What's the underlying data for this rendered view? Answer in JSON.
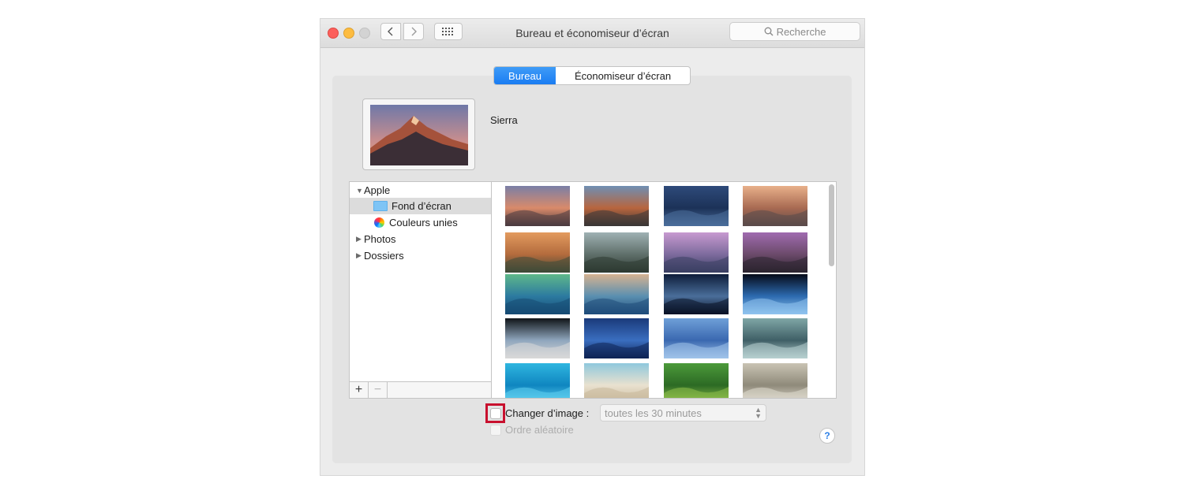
{
  "window": {
    "title": "Bureau et économiseur d’écran",
    "search_placeholder": "Recherche",
    "traffic_lights": {
      "close": "#fc605c",
      "minimize": "#fdbc40",
      "maximize": "#d3d3d3"
    },
    "nav_icons": [
      "chevron-left-icon",
      "chevron-right-icon",
      "grid-icon"
    ]
  },
  "tabs": [
    {
      "label": "Bureau",
      "selected": true
    },
    {
      "label": "Économiseur d’écran",
      "selected": false
    }
  ],
  "current_wallpaper": {
    "name": "Sierra"
  },
  "source_list": {
    "items": [
      {
        "label": "Apple",
        "type": "group",
        "expanded": true
      },
      {
        "label": "Fond d’écran",
        "type": "folder",
        "selected": true
      },
      {
        "label": "Couleurs unies",
        "type": "colors",
        "selected": false
      },
      {
        "label": "Photos",
        "type": "group",
        "expanded": false
      },
      {
        "label": "Dossiers",
        "type": "group",
        "expanded": false
      }
    ],
    "add_label": "+",
    "remove_label": "−"
  },
  "wallpaper_grid": [
    {
      "name": "sierra",
      "colors": [
        "#7a7fa6",
        "#d98a6a",
        "#4a3b3f"
      ]
    },
    {
      "name": "el-capitan",
      "colors": [
        "#6f8fb3",
        "#b8653e",
        "#3a3636"
      ]
    },
    {
      "name": "mountain-night",
      "colors": [
        "#2e4a7a",
        "#1c3258",
        "#4b6d9a"
      ]
    },
    {
      "name": "yosemite-dusk",
      "colors": [
        "#e8b08a",
        "#a86a52",
        "#5a4a4a"
      ]
    },
    {
      "name": "yosemite-sunset",
      "colors": [
        "#e39b5f",
        "#b36b3d",
        "#3e4a38"
      ]
    },
    {
      "name": "yosemite-forest",
      "colors": [
        "#9fb1b3",
        "#5f6f6a",
        "#2d3a32"
      ]
    },
    {
      "name": "half-dome-pink",
      "colors": [
        "#c79ad0",
        "#7d6b9d",
        "#3a3f63"
      ]
    },
    {
      "name": "lake-rocks",
      "colors": [
        "#a06bb0",
        "#6b4a6a",
        "#2c2430"
      ]
    },
    {
      "name": "green-wave",
      "colors": [
        "#5fb88a",
        "#2c7aa0",
        "#164a73"
      ]
    },
    {
      "name": "ocean-wave",
      "colors": [
        "#d6b391",
        "#5a8fb0",
        "#1f4c7a"
      ]
    },
    {
      "name": "galaxy",
      "colors": [
        "#0e1d3a",
        "#4a6e9a",
        "#0a1226"
      ]
    },
    {
      "name": "earth-horizon",
      "colors": [
        "#050a18",
        "#2d6bb0",
        "#8fc3ee"
      ]
    },
    {
      "name": "earth-from-space",
      "colors": [
        "#101418",
        "#8fa6bd",
        "#d8d8d8"
      ]
    },
    {
      "name": "blue-nebula",
      "colors": [
        "#1a3a7a",
        "#3a6ec0",
        "#0e2456"
      ]
    },
    {
      "name": "blue-sky",
      "colors": [
        "#6fa0d8",
        "#3a68b0",
        "#9fc2ea"
      ]
    },
    {
      "name": "clouds",
      "colors": [
        "#7fa6a6",
        "#3f5f66",
        "#b6cfcf"
      ]
    },
    {
      "name": "aqua-water",
      "colors": [
        "#2fb6e0",
        "#0f86c0",
        "#5fd0f0"
      ]
    },
    {
      "name": "beach",
      "colors": [
        "#8fc8dd",
        "#e9e1cf",
        "#c9b89a"
      ]
    },
    {
      "name": "rice-fields",
      "colors": [
        "#4c9a3a",
        "#2c6a24",
        "#8fc04a"
      ]
    },
    {
      "name": "fog-forest",
      "colors": [
        "#c9c3b3",
        "#8f8a7a",
        "#e0dcd0"
      ]
    }
  ],
  "options": {
    "change_picture_label": "Changer d’image :",
    "change_picture_checked": false,
    "interval_value": "toutes les 30 minutes",
    "random_order_label": "Ordre aléatoire",
    "random_order_enabled": false,
    "help_label": "?"
  }
}
